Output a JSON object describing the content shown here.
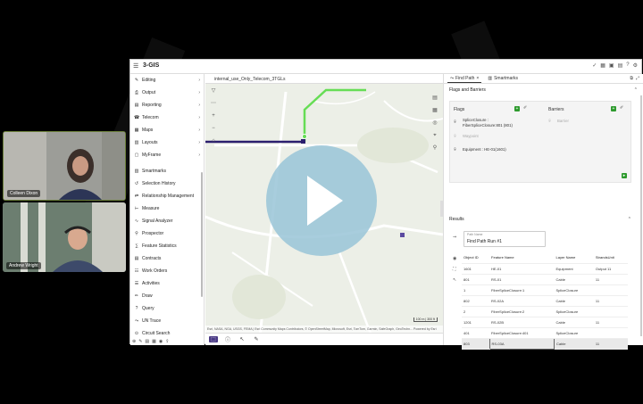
{
  "participants": [
    {
      "name": "Colleen Dixon"
    },
    {
      "name": "Andrew Wright"
    }
  ],
  "app": {
    "logo": "3-GIS",
    "menu": [
      {
        "label": "Editing",
        "icon": "pencil-icon",
        "submenu": true
      },
      {
        "label": "Output",
        "icon": "print-icon",
        "submenu": true
      },
      {
        "label": "Reporting",
        "icon": "report-icon",
        "submenu": true
      },
      {
        "label": "Telecom",
        "icon": "phone-icon",
        "submenu": true
      },
      {
        "label": "Maps",
        "icon": "map-icon",
        "submenu": true
      },
      {
        "label": "Layouts",
        "icon": "layout-icon",
        "submenu": true
      },
      {
        "label": "MyFrame",
        "icon": "frame-icon",
        "submenu": true
      },
      {
        "label": "Smartmarks",
        "icon": "bookmark-icon",
        "submenu": false
      },
      {
        "label": "Selection History",
        "icon": "history-icon",
        "submenu": false
      },
      {
        "label": "Relationship Management",
        "icon": "relationship-icon",
        "submenu": false
      },
      {
        "label": "Measure",
        "icon": "ruler-icon",
        "submenu": false
      },
      {
        "label": "Signal Analyzer",
        "icon": "signal-icon",
        "submenu": false
      },
      {
        "label": "Prospector",
        "icon": "prospector-icon",
        "submenu": false
      },
      {
        "label": "Feature Statistics",
        "icon": "statistics-icon",
        "submenu": false
      },
      {
        "label": "Contracts",
        "icon": "contract-icon",
        "submenu": false
      },
      {
        "label": "Work Orders",
        "icon": "workorder-icon",
        "submenu": false
      },
      {
        "label": "Activities",
        "icon": "activity-icon",
        "submenu": false
      },
      {
        "label": "Draw",
        "icon": "draw-icon",
        "submenu": false
      },
      {
        "label": "Query",
        "icon": "query-icon",
        "submenu": false
      },
      {
        "label": "UN Trace",
        "icon": "trace-icon",
        "submenu": false
      },
      {
        "label": "Circuit Search",
        "icon": "circuit-icon",
        "submenu": false
      }
    ],
    "map": {
      "tab_label": "internal_use_Only_Telecom_3TGLs",
      "attribution": "Esri, NASA, NGA, USGS, FEMA | Esri Community Maps Contributors, © OpenStreetMap, Microsoft, Esri, TomTom, Garmin, SafeGraph, GeoTechn...   Powered by Esri",
      "scale": "100 m | 300 ft"
    },
    "panel": {
      "tabs": [
        "Find Path",
        "Smartmarks"
      ],
      "flags_barriers_title": "Flags and Barriers",
      "flags_title": "Flags",
      "barriers_title": "Barriers",
      "flag_items": [
        "SpliceClosure :",
        "FiberSpliceClosure:801 (801)"
      ],
      "waypoint_placeholder": "Waypoint",
      "equipment_item": "Equipment : HE-01(1601)",
      "barrier_placeholder": "Barrier",
      "results_title": "Results",
      "path_name_label": "Path Name",
      "path_name_value": "Find Path Run #1",
      "table": {
        "headers": [
          "Object ID",
          "Feature Name",
          "Layer Name",
          "StrandsUnit"
        ],
        "rows": [
          [
            "1601",
            "HE-01",
            "Equipment",
            "Output 11"
          ],
          [
            "801",
            "RS-01",
            "Cable",
            "11"
          ],
          [
            "1",
            "FiberSpliceClosure:1",
            "SpliceClosure",
            ""
          ],
          [
            "802",
            "RS-02A",
            "Cable",
            "11"
          ],
          [
            "2",
            "FiberSpliceClosure:2",
            "SpliceClosure",
            ""
          ],
          [
            "1201",
            "RS-02B",
            "Cable",
            "11"
          ],
          [
            "401",
            "FiberSpliceClosure:401",
            "SpliceClosure",
            ""
          ],
          [
            "803",
            "RS-03A",
            "Cable",
            "11"
          ]
        ]
      }
    }
  },
  "colors": {
    "accent": "#4b3b86",
    "route_green": "#66dd55",
    "route_purple": "#2b1f6e",
    "play_overlay": "#99c4d7",
    "status_green": "#2d9a2d"
  }
}
